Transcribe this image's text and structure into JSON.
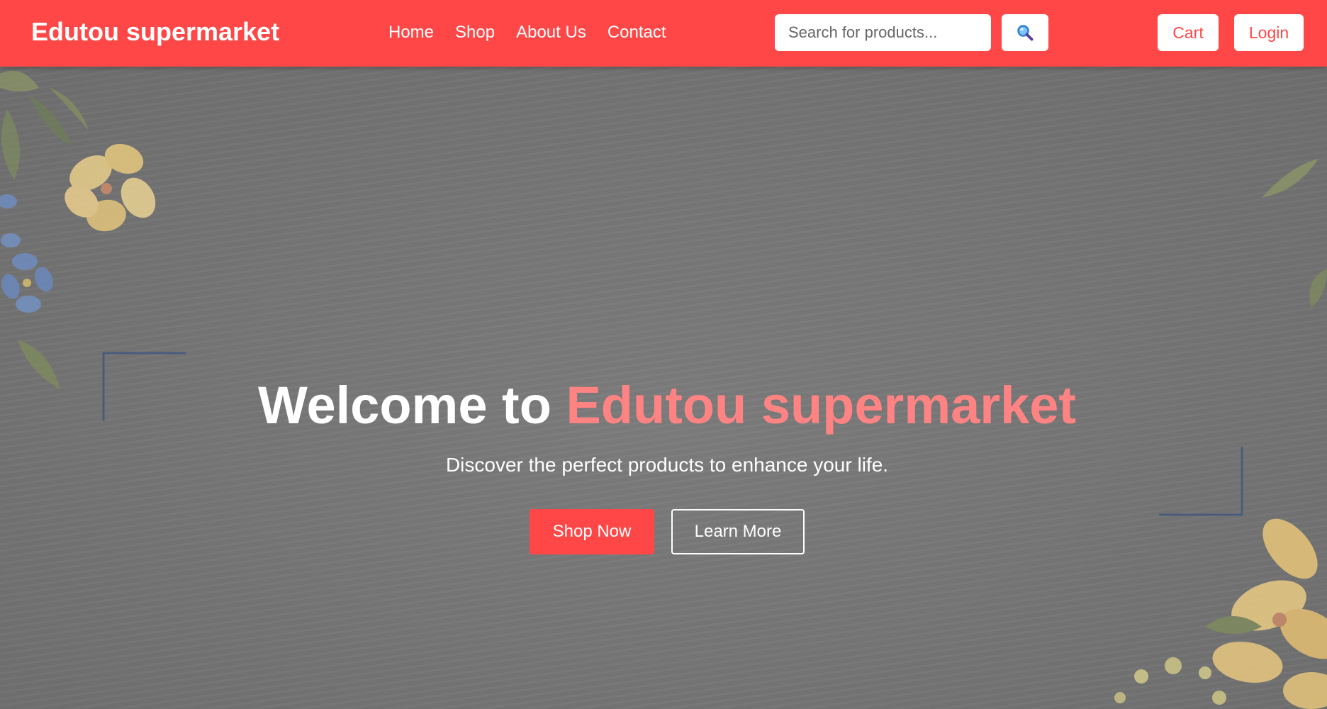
{
  "header": {
    "brand": "Edutou supermarket",
    "nav": [
      "Home",
      "Shop",
      "About Us",
      "Contact"
    ],
    "search": {
      "placeholder": "Search for products...",
      "value": "",
      "icon": "magnifier-icon"
    },
    "cart_label": "Cart",
    "login_label": "Login"
  },
  "hero": {
    "title_prefix": "Welcome to ",
    "title_accent": "Edutou supermarket",
    "subtitle": "Discover the perfect products to enhance your life.",
    "primary_cta": "Shop Now",
    "secondary_cta": "Learn More"
  },
  "colors": {
    "brand_red": "#ff4747",
    "accent_pink": "#ff8383",
    "hero_overlay": "#747474",
    "frame_blue": "#4a5c7c"
  }
}
